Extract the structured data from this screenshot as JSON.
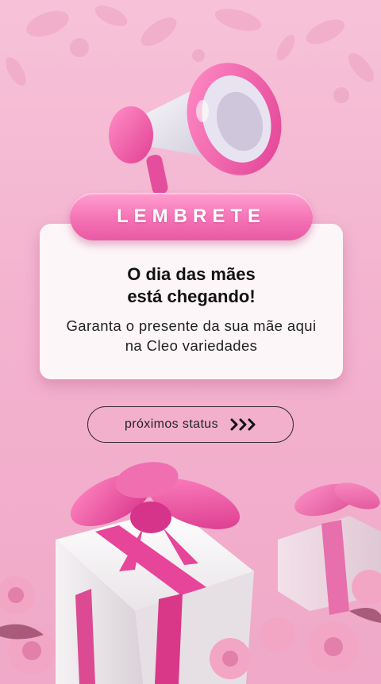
{
  "reminder": {
    "badge_label": "LEMBRETE",
    "title": "O dia das mães\nestá chegando!",
    "subtitle": "Garanta o presente da sua mãe aqui na Cleo variedades"
  },
  "next_button": {
    "label": "próximos status",
    "icon": "triple-chevron-right-icon"
  },
  "colors": {
    "background": "#f3b3cf",
    "accent_pink": "#f36fb3",
    "card": "#fdf6f9",
    "gift_white": "#f4f1f2",
    "ribbon": "#e6459a"
  }
}
